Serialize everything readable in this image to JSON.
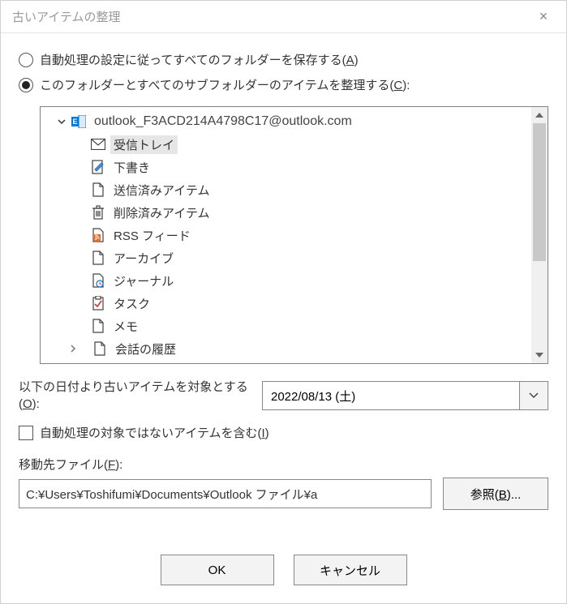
{
  "window": {
    "title": "古いアイテムの整理",
    "close_icon": "×"
  },
  "radio1": {
    "label_pre": "自動処理の設定に従ってすべてのフォルダーを保存する(",
    "access": "A",
    "label_post": ")"
  },
  "radio2": {
    "label_pre": "このフォルダーとすべてのサブフォルダーのアイテムを整理する(",
    "access": "C",
    "label_post": "):"
  },
  "tree": {
    "root": "outlook_F3ACD214A4798C17@outlook.com",
    "items": [
      "受信トレイ",
      "下書き",
      "送信済みアイテム",
      "削除済みアイテム",
      "RSS フィード",
      "アーカイブ",
      "ジャーナル",
      "タスク",
      "メモ",
      "会話の履歴"
    ]
  },
  "date": {
    "label_pre": "以下の日付より古いアイテムを対象とする(",
    "access": "O",
    "label_post": "):",
    "value": "2022/08/13 (土)"
  },
  "include": {
    "label_pre": "自動処理の対象ではないアイテムを含む(",
    "access": "I",
    "label_post": ")"
  },
  "file": {
    "label_pre": "移動先ファイル(",
    "access": "F",
    "label_post": "):",
    "path": "C:¥Users¥Toshifumi¥Documents¥Outlook ファイル¥a",
    "browse_pre": "参照(",
    "browse_access": "B",
    "browse_post": ")..."
  },
  "buttons": {
    "ok": "OK",
    "cancel": "キャンセル"
  }
}
